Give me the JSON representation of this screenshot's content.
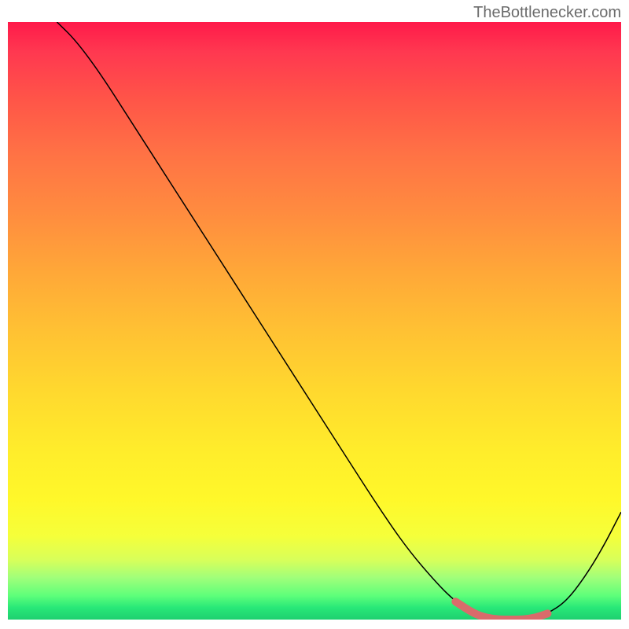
{
  "watermark": "TheBottlenecker.com",
  "chart_data": {
    "type": "line",
    "title": "",
    "xlabel": "",
    "ylabel": "",
    "xlim": [
      0,
      100
    ],
    "ylim": [
      0,
      100
    ],
    "series": [
      {
        "name": "bottleneck-curve",
        "x": [
          8,
          11,
          15,
          20,
          25,
          30,
          35,
          40,
          45,
          50,
          55,
          60,
          65,
          70,
          73,
          76,
          78,
          80,
          82,
          84,
          86,
          88,
          91,
          94,
          97,
          100
        ],
        "y": [
          100,
          97,
          91.5,
          83.5,
          75.5,
          67.5,
          59.5,
          51.5,
          43.5,
          35.5,
          27.5,
          19.5,
          12,
          6,
          3,
          1,
          0.3,
          0,
          0,
          0,
          0.3,
          1,
          3,
          7,
          12,
          18
        ]
      },
      {
        "name": "highlight-segment",
        "x": [
          73,
          76,
          78,
          80,
          82,
          84,
          86,
          88
        ],
        "y": [
          3,
          1,
          0.3,
          0,
          0,
          0,
          0.3,
          1
        ]
      }
    ],
    "gradient_colors": {
      "top": "#ff1a4a",
      "bottom": "#1ed070"
    },
    "highlight_color": "#d96b6b"
  }
}
